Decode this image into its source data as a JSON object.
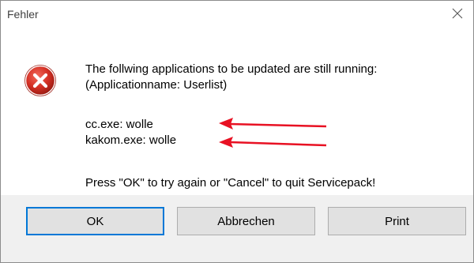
{
  "dialog": {
    "title": "Fehler",
    "close_icon": "close-icon",
    "icon": "error-icon",
    "message_line1": "The follwing applications to be updated are still running:",
    "message_line2": "(Applicationname: Userlist)",
    "apps": [
      {
        "label": "cc.exe: wolle"
      },
      {
        "label": "kakom.exe: wolle"
      }
    ],
    "instruction": "Press \"OK\" to try again or \"Cancel\" to quit Servicepack!",
    "buttons": {
      "ok_label": "OK",
      "cancel_label": "Abbrechen",
      "print_label": "Print"
    },
    "colors": {
      "error_red": "#c42b1c",
      "arrow_red": "#e81123",
      "accent": "#0078d7",
      "footer_bg": "#f0f0f0"
    }
  }
}
